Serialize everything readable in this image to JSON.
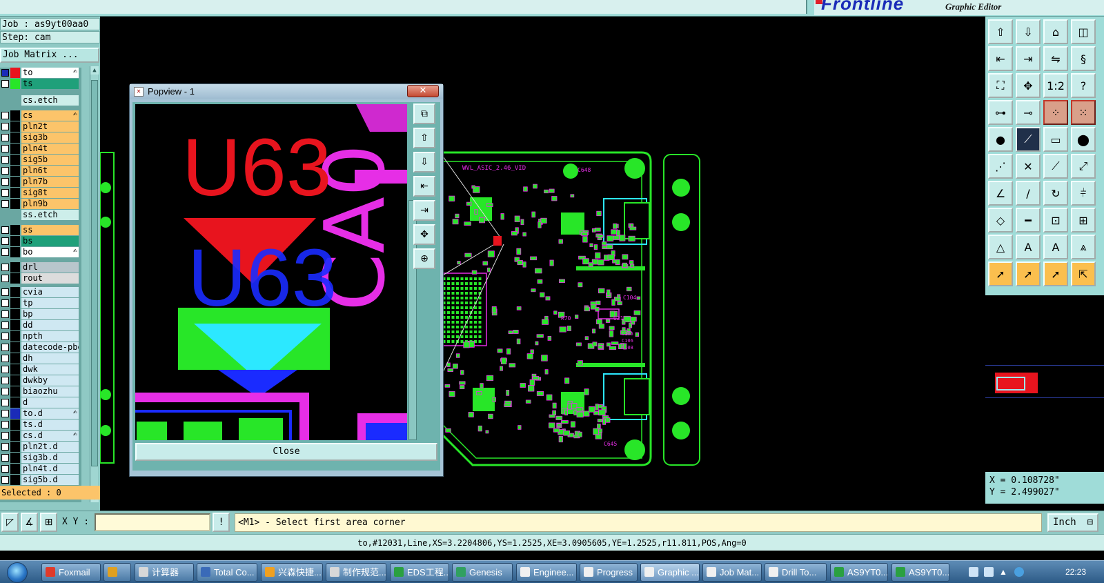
{
  "topbar": {
    "logo_text": "Frontline",
    "app_subtitle": "Graphic Editor"
  },
  "left_panel": {
    "job_line": "Job : as9yt00aa0",
    "step_line": "Step: cam",
    "job_matrix_button": "Job Matrix ...",
    "selected_text": "Selected : 0",
    "layers": [
      {
        "name": "to",
        "row_color": "#ffffff",
        "swatch": "#e8141e",
        "cb_color": "#1a2bb8",
        "mark": "✍"
      },
      {
        "name": "ts",
        "row_color": "#1fa07a",
        "swatch": "#28e628",
        "cb_color": "#ffffff",
        "mark": ""
      },
      {
        "name": "cs.etch",
        "row_color": "#cdeeea",
        "swatch": "",
        "cb_color": "",
        "mark": ""
      },
      {
        "name": "cs",
        "row_color": "#fcc46a",
        "swatch": "#000000",
        "cb_color": "#ffffff",
        "mark": "✍"
      },
      {
        "name": "pln2t",
        "row_color": "#fcc46a",
        "swatch": "#000000",
        "cb_color": "#ffffff",
        "mark": ""
      },
      {
        "name": "sig3b",
        "row_color": "#fcc46a",
        "swatch": "#000000",
        "cb_color": "#ffffff",
        "mark": ""
      },
      {
        "name": "pln4t",
        "row_color": "#fcc46a",
        "swatch": "#000000",
        "cb_color": "#ffffff",
        "mark": ""
      },
      {
        "name": "sig5b",
        "row_color": "#fcc46a",
        "swatch": "#000000",
        "cb_color": "#ffffff",
        "mark": ""
      },
      {
        "name": "pln6t",
        "row_color": "#fcc46a",
        "swatch": "#000000",
        "cb_color": "#ffffff",
        "mark": ""
      },
      {
        "name": "pln7b",
        "row_color": "#fcc46a",
        "swatch": "#000000",
        "cb_color": "#ffffff",
        "mark": ""
      },
      {
        "name": "sig8t",
        "row_color": "#fcc46a",
        "swatch": "#000000",
        "cb_color": "#ffffff",
        "mark": ""
      },
      {
        "name": "pln9b",
        "row_color": "#fcc46a",
        "swatch": "#000000",
        "cb_color": "#ffffff",
        "mark": ""
      },
      {
        "name": "ss.etch",
        "row_color": "#cdeeea",
        "swatch": "",
        "cb_color": "",
        "mark": ""
      },
      {
        "name": "ss",
        "row_color": "#fcc46a",
        "swatch": "#000000",
        "cb_color": "#ffffff",
        "mark": ""
      },
      {
        "name": "bs",
        "row_color": "#1fa07a",
        "swatch": "#000000",
        "cb_color": "#ffffff",
        "mark": ""
      },
      {
        "name": "bo",
        "row_color": "#ffffff",
        "swatch": "#000000",
        "cb_color": "#ffffff",
        "mark": "✍"
      },
      {
        "name": "drl",
        "row_color": "#b8c6cc",
        "swatch": "#000000",
        "cb_color": "#ffffff",
        "mark": ""
      },
      {
        "name": "rout",
        "row_color": "#dcdcdc",
        "swatch": "#000000",
        "cb_color": "#ffffff",
        "mark": ""
      },
      {
        "name": "cvia",
        "row_color": "#cfe8f2",
        "swatch": "#000000",
        "cb_color": "#ffffff",
        "mark": ""
      },
      {
        "name": "tp",
        "row_color": "#cfe8f2",
        "swatch": "#000000",
        "cb_color": "#ffffff",
        "mark": ""
      },
      {
        "name": "bp",
        "row_color": "#cfe8f2",
        "swatch": "#000000",
        "cb_color": "#ffffff",
        "mark": ""
      },
      {
        "name": "dd",
        "row_color": "#cfe8f2",
        "swatch": "#000000",
        "cb_color": "#ffffff",
        "mark": ""
      },
      {
        "name": "npth",
        "row_color": "#cfe8f2",
        "swatch": "#000000",
        "cb_color": "#ffffff",
        "mark": ""
      },
      {
        "name": "datecode-pbe",
        "row_color": "#cfe8f2",
        "swatch": "#000000",
        "cb_color": "#ffffff",
        "mark": ""
      },
      {
        "name": "dh",
        "row_color": "#cfe8f2",
        "swatch": "#000000",
        "cb_color": "#ffffff",
        "mark": ""
      },
      {
        "name": "dwk",
        "row_color": "#cfe8f2",
        "swatch": "#000000",
        "cb_color": "#ffffff",
        "mark": ""
      },
      {
        "name": "dwkby",
        "row_color": "#cfe8f2",
        "swatch": "#000000",
        "cb_color": "#ffffff",
        "mark": ""
      },
      {
        "name": "biaozhu",
        "row_color": "#cfe8f2",
        "swatch": "#000000",
        "cb_color": "#ffffff",
        "mark": ""
      },
      {
        "name": "d",
        "row_color": "#cfe8f2",
        "swatch": "#000000",
        "cb_color": "#ffffff",
        "mark": ""
      },
      {
        "name": "to.d",
        "row_color": "#cfe8f2",
        "swatch": "#1a2bb8",
        "cb_color": "#ffffff",
        "mark": "✍"
      },
      {
        "name": "ts.d",
        "row_color": "#cfe8f2",
        "swatch": "#000000",
        "cb_color": "#ffffff",
        "mark": ""
      },
      {
        "name": "cs.d",
        "row_color": "#cfe8f2",
        "swatch": "#000000",
        "cb_color": "#ffffff",
        "mark": "✍"
      },
      {
        "name": "pln2t.d",
        "row_color": "#cfe8f2",
        "swatch": "#000000",
        "cb_color": "#ffffff",
        "mark": ""
      },
      {
        "name": "sig3b.d",
        "row_color": "#cfe8f2",
        "swatch": "#000000",
        "cb_color": "#ffffff",
        "mark": ""
      },
      {
        "name": "pln4t.d",
        "row_color": "#cfe8f2",
        "swatch": "#000000",
        "cb_color": "#ffffff",
        "mark": ""
      },
      {
        "name": "sig5b.d",
        "row_color": "#cfe8f2",
        "swatch": "#000000",
        "cb_color": "#ffffff",
        "mark": ""
      }
    ]
  },
  "popview": {
    "title": "Popview - 1",
    "close_button": "Close",
    "zoom_labels": [
      "U63",
      "U63"
    ],
    "tool_icons": [
      "zoom-window-icon",
      "zoom-in-icon",
      "zoom-out-icon",
      "pan-left-icon",
      "pan-right-icon",
      "fit-icon",
      "reset-icon"
    ]
  },
  "canvas": {
    "board_labels": [
      "WVL_ASIC_2.46_VID",
      "U49",
      "U72",
      "U21",
      "U60",
      "U73",
      "L27",
      "C104",
      "C106",
      "C108",
      "C216",
      "C217",
      "C218",
      "C237",
      "C238",
      "C645",
      "C648",
      "R473",
      "R475",
      "R70",
      "L51",
      "C105"
    ]
  },
  "right_panel": {
    "tools": [
      {
        "icon": "⇧",
        "name": "move-up-tool",
        "style": ""
      },
      {
        "icon": "⇩",
        "name": "move-down-tool",
        "style": ""
      },
      {
        "icon": "⌂",
        "name": "home-tool",
        "style": ""
      },
      {
        "icon": "◫",
        "name": "window-tool",
        "style": ""
      },
      {
        "icon": "⇤",
        "name": "align-left-tool",
        "style": ""
      },
      {
        "icon": "⇥",
        "name": "align-right-tool",
        "style": ""
      },
      {
        "icon": "⇋",
        "name": "swap-tool",
        "style": ""
      },
      {
        "icon": "§",
        "name": "script-tool",
        "style": ""
      },
      {
        "icon": "⛶",
        "name": "fit-screen-tool",
        "style": ""
      },
      {
        "icon": "✥",
        "name": "pan-tool",
        "style": ""
      },
      {
        "icon": "1:2",
        "name": "scale-tool",
        "style": ""
      },
      {
        "icon": "?",
        "name": "help-tool",
        "style": ""
      },
      {
        "icon": "⊶",
        "name": "connect-tool",
        "style": ""
      },
      {
        "icon": "⊸",
        "name": "probe-tool",
        "style": ""
      },
      {
        "icon": "⁘",
        "name": "net-tool-1",
        "style": "orange-border"
      },
      {
        "icon": "⁙",
        "name": "net-tool-2",
        "style": "orange-border"
      },
      {
        "icon": "●",
        "name": "pad-tool",
        "style": ""
      },
      {
        "icon": "⟋",
        "name": "line-tool",
        "style": "dark"
      },
      {
        "icon": "▭",
        "name": "ruler-tool",
        "style": ""
      },
      {
        "icon": "⬤",
        "name": "circle-tool",
        "style": ""
      },
      {
        "icon": "⋰",
        "name": "node-tool",
        "style": ""
      },
      {
        "icon": "✕",
        "name": "delete-tool",
        "style": ""
      },
      {
        "icon": "⟋",
        "name": "segment-tool",
        "style": ""
      },
      {
        "icon": "⤢",
        "name": "stretch-tool",
        "style": ""
      },
      {
        "icon": "∠",
        "name": "angle-tool",
        "style": ""
      },
      {
        "icon": "/",
        "name": "slash-tool",
        "style": ""
      },
      {
        "icon": "↻",
        "name": "rotate-tool",
        "style": ""
      },
      {
        "icon": "⫩",
        "name": "split-tool",
        "style": ""
      },
      {
        "icon": "◇",
        "name": "shape-tool",
        "style": ""
      },
      {
        "icon": "━",
        "name": "bar-tool",
        "style": ""
      },
      {
        "icon": "⊡",
        "name": "box-tool",
        "style": ""
      },
      {
        "icon": "⊞",
        "name": "grid-tool",
        "style": ""
      },
      {
        "icon": "△",
        "name": "triangle-tool",
        "style": ""
      },
      {
        "icon": "A",
        "name": "text-tool",
        "style": ""
      },
      {
        "icon": "A",
        "name": "text-edit-tool",
        "style": ""
      },
      {
        "icon": "⩓",
        "name": "arc-tool",
        "style": ""
      },
      {
        "icon": "➚",
        "name": "select-tool",
        "style": "orange"
      },
      {
        "icon": "➚",
        "name": "select-area-tool",
        "style": "orange"
      },
      {
        "icon": "➚",
        "name": "select-poly-tool",
        "style": "orange"
      },
      {
        "icon": "⇱",
        "name": "select-multi-tool",
        "style": "orange"
      }
    ],
    "coord_x": "X = 0.108728\"",
    "coord_y": "Y = 2.499027\""
  },
  "command_bar": {
    "xy_label": "X Y :",
    "xy_placeholder": "",
    "bang_button": "!",
    "prompt": "<M1> - Select first area corner",
    "unit": "Inch"
  },
  "status_line": "to,#12031,Line,XS=3.2204806,YS=1.2525,XE=3.0905605,YE=1.2525,r11.811,POS,Ang=0",
  "taskbar": {
    "items": [
      {
        "label": "Foxmail",
        "color": "#e03a2a",
        "active": false
      },
      {
        "label": "",
        "color": "#e0a020",
        "active": false
      },
      {
        "label": "计算器",
        "color": "#d8d8d8",
        "active": false
      },
      {
        "label": "Total Co...",
        "color": "#3a6ab8",
        "active": false
      },
      {
        "label": "兴森快捷...",
        "color": "#f0a020",
        "active": false
      },
      {
        "label": "制作规范...",
        "color": "#d8d8d8",
        "active": false
      },
      {
        "label": "EDS工程...",
        "color": "#2aa040",
        "active": false
      },
      {
        "label": "Genesis",
        "color": "#30a060",
        "active": false
      },
      {
        "label": "Enginee...",
        "color": "#f0f0f0",
        "active": false
      },
      {
        "label": "Progress",
        "color": "#f0f0f0",
        "active": false
      },
      {
        "label": "Graphic ...",
        "color": "#f0f0f0",
        "active": true
      },
      {
        "label": "Job Mat...",
        "color": "#f0f0f0",
        "active": false
      },
      {
        "label": "Drill To...",
        "color": "#f0f0f0",
        "active": false
      },
      {
        "label": "AS9YT0...",
        "color": "#2aa040",
        "active": false
      },
      {
        "label": "AS9YT0...",
        "color": "#2aa040",
        "active": false
      }
    ],
    "clock": "22:23"
  }
}
